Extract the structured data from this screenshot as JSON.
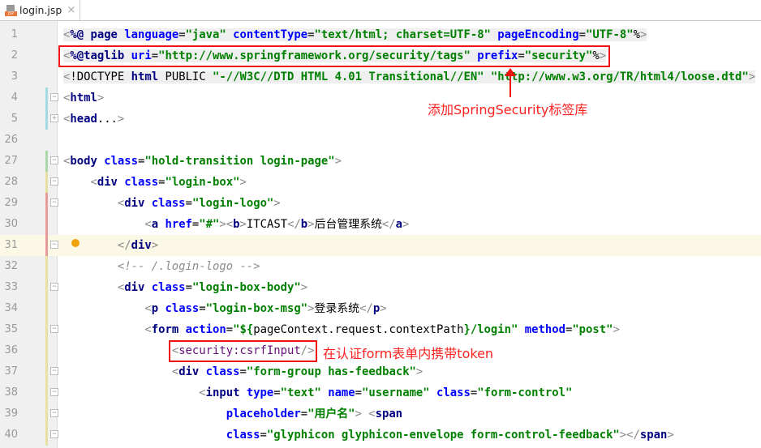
{
  "tab": {
    "file_name": "login.jsp",
    "close_icon": "×",
    "icon": "jsp-file-icon"
  },
  "colors": {
    "annotation": "#ee1111",
    "tag": "#000080",
    "attribute": "#0000ff",
    "value": "#008000",
    "current_line": "#fcf8e6"
  },
  "lines": [
    {
      "n": "1",
      "fold": "",
      "shade": true,
      "tokens": [
        [
          "br",
          "<"
        ],
        [
          "tg",
          "%@ page "
        ],
        [
          "at",
          "language"
        ],
        [
          "tx",
          "="
        ],
        [
          "vl",
          "\"java\" "
        ],
        [
          "at",
          "contentType"
        ],
        [
          "tx",
          "="
        ],
        [
          "vl",
          "\"text/html; charset=UTF-8\" "
        ],
        [
          "at",
          "pageEncoding"
        ],
        [
          "tx",
          "="
        ],
        [
          "vl",
          "\"UTF-8\""
        ],
        [
          "tx",
          "%"
        ],
        [
          "br",
          ">"
        ]
      ]
    },
    {
      "n": "2",
      "fold": "",
      "shade": true,
      "tokens": [
        [
          "br",
          "<"
        ],
        [
          "tg",
          "%@taglib "
        ],
        [
          "at",
          "uri"
        ],
        [
          "tx",
          "="
        ],
        [
          "vl",
          "\"http://www.springframework.org/security/tags\" "
        ],
        [
          "at",
          "prefix"
        ],
        [
          "tx",
          "="
        ],
        [
          "vl",
          "\"security\""
        ],
        [
          "tx",
          "%"
        ],
        [
          "br",
          ">"
        ]
      ]
    },
    {
      "n": "3",
      "fold": "",
      "shade": true,
      "tokens": [
        [
          "br",
          "<"
        ],
        [
          "tx",
          "!DOCTYPE "
        ],
        [
          "tg",
          "html "
        ],
        [
          "tx",
          "PUBLIC "
        ],
        [
          "vl",
          "\"-//W3C//DTD HTML 4.01 Transitional//EN\" \"http://www.w3.org/TR/html4/loose.dtd\""
        ],
        [
          "br",
          ">"
        ]
      ]
    },
    {
      "n": "4",
      "fold": "−",
      "shade": false,
      "tokens": [
        [
          "br",
          "<"
        ],
        [
          "tg",
          "html"
        ],
        [
          "br",
          ">"
        ]
      ]
    },
    {
      "n": "5",
      "fold": "+",
      "shade": false,
      "tokens": [
        [
          "br",
          "<"
        ],
        [
          "tg",
          "head"
        ],
        [
          "tx",
          "..."
        ],
        [
          "br",
          ">"
        ]
      ]
    },
    {
      "n": "26",
      "fold": "",
      "shade": false,
      "tokens": []
    },
    {
      "n": "27",
      "fold": "−",
      "shade": false,
      "tokens": [
        [
          "br",
          "<"
        ],
        [
          "tg",
          "body "
        ],
        [
          "at",
          "class"
        ],
        [
          "tx",
          "="
        ],
        [
          "vl",
          "\"hold-transition login-page\""
        ],
        [
          "br",
          ">"
        ]
      ]
    },
    {
      "n": "28",
      "fold": "−",
      "shade": false,
      "indent": "    ",
      "tokens": [
        [
          "br",
          "<"
        ],
        [
          "tg",
          "div "
        ],
        [
          "at",
          "class"
        ],
        [
          "tx",
          "="
        ],
        [
          "vl",
          "\"login-box\""
        ],
        [
          "br",
          ">"
        ]
      ]
    },
    {
      "n": "29",
      "fold": "−",
      "shade": false,
      "indent": "        ",
      "tokens": [
        [
          "br",
          "<"
        ],
        [
          "tg",
          "div "
        ],
        [
          "at",
          "class"
        ],
        [
          "tx",
          "="
        ],
        [
          "vl",
          "\"login-logo\""
        ],
        [
          "br",
          ">"
        ]
      ]
    },
    {
      "n": "30",
      "fold": "",
      "shade": false,
      "indent": "            ",
      "tokens": [
        [
          "br",
          "<"
        ],
        [
          "tg",
          "a "
        ],
        [
          "at",
          "href"
        ],
        [
          "tx",
          "="
        ],
        [
          "vl",
          "\"#\""
        ],
        [
          "br",
          "><"
        ],
        [
          "tg",
          "b"
        ],
        [
          "br",
          ">"
        ],
        [
          "tx",
          "ITCAST"
        ],
        [
          "br",
          "</"
        ],
        [
          "tg",
          "b"
        ],
        [
          "br",
          ">"
        ],
        [
          "tx",
          "后台管理系统"
        ],
        [
          "br",
          "</"
        ],
        [
          "tg",
          "a"
        ],
        [
          "br",
          ">"
        ]
      ]
    },
    {
      "n": "31",
      "fold": "−",
      "shade": false,
      "current": true,
      "bulb": true,
      "indent": "        ",
      "tokens": [
        [
          "br",
          "</"
        ],
        [
          "tg",
          "div"
        ],
        [
          "br",
          ">"
        ]
      ]
    },
    {
      "n": "32",
      "fold": "",
      "shade": false,
      "indent": "        ",
      "tokens": [
        [
          "cm",
          "<!-- /.login-logo -->"
        ]
      ]
    },
    {
      "n": "33",
      "fold": "−",
      "shade": false,
      "indent": "        ",
      "tokens": [
        [
          "br",
          "<"
        ],
        [
          "tg",
          "div "
        ],
        [
          "at",
          "class"
        ],
        [
          "tx",
          "="
        ],
        [
          "vl",
          "\"login-box-body\""
        ],
        [
          "br",
          ">"
        ]
      ]
    },
    {
      "n": "34",
      "fold": "",
      "shade": false,
      "indent": "            ",
      "tokens": [
        [
          "br",
          "<"
        ],
        [
          "tg",
          "p "
        ],
        [
          "at",
          "class"
        ],
        [
          "tx",
          "="
        ],
        [
          "vl",
          "\"login-box-msg\""
        ],
        [
          "br",
          ">"
        ],
        [
          "tx",
          "登录系统"
        ],
        [
          "br",
          "</"
        ],
        [
          "tg",
          "p"
        ],
        [
          "br",
          ">"
        ]
      ]
    },
    {
      "n": "35",
      "fold": "−",
      "shade": false,
      "indent": "            ",
      "tokens": [
        [
          "br",
          "<"
        ],
        [
          "tg",
          "form "
        ],
        [
          "at",
          "action"
        ],
        [
          "tx",
          "="
        ],
        [
          "vl",
          "\"${"
        ],
        [
          "tx",
          "pageContext.request.contextPath"
        ],
        [
          "vl",
          "}/login\" "
        ],
        [
          "at",
          "method"
        ],
        [
          "tx",
          "="
        ],
        [
          "vl",
          "\"post\""
        ],
        [
          "br",
          ">"
        ]
      ]
    },
    {
      "n": "36",
      "fold": "",
      "shade": false,
      "indent": "                ",
      "tokens": [
        [
          "br",
          "<"
        ],
        [
          "sc",
          "security:csrfInput"
        ],
        [
          "br",
          "/>"
        ]
      ]
    },
    {
      "n": "37",
      "fold": "−",
      "shade": false,
      "indent": "                ",
      "tokens": [
        [
          "br",
          "<"
        ],
        [
          "tg",
          "div "
        ],
        [
          "at",
          "class"
        ],
        [
          "tx",
          "="
        ],
        [
          "vl",
          "\"form-group has-feedback\""
        ],
        [
          "br",
          ">"
        ]
      ]
    },
    {
      "n": "38",
      "fold": "−",
      "shade": false,
      "indent": "                    ",
      "tokens": [
        [
          "br",
          "<"
        ],
        [
          "tg",
          "input "
        ],
        [
          "at",
          "type"
        ],
        [
          "tx",
          "="
        ],
        [
          "vl",
          "\"text\" "
        ],
        [
          "at",
          "name"
        ],
        [
          "tx",
          "="
        ],
        [
          "vl",
          "\"username\" "
        ],
        [
          "at",
          "class"
        ],
        [
          "tx",
          "="
        ],
        [
          "vl",
          "\"form-control\""
        ]
      ]
    },
    {
      "n": "39",
      "fold": "−",
      "shade": false,
      "indent": "                        ",
      "tokens": [
        [
          "at",
          "placeholder"
        ],
        [
          "tx",
          "="
        ],
        [
          "vl",
          "\"用户名\""
        ],
        [
          "br",
          "> <"
        ],
        [
          "tg",
          "span"
        ]
      ]
    },
    {
      "n": "40",
      "fold": "−",
      "shade": false,
      "indent": "                        ",
      "tokens": [
        [
          "at",
          "class"
        ],
        [
          "tx",
          "="
        ],
        [
          "vl",
          "\"glyphicon glyphicon-envelope form-control-feedback\""
        ],
        [
          "br",
          "></"
        ],
        [
          "tg",
          "span"
        ],
        [
          "br",
          ">"
        ]
      ]
    }
  ],
  "annotations": {
    "taglib_note": "添加SpringSecurity标签库",
    "csrf_note": "在认证form表单内携带token"
  }
}
